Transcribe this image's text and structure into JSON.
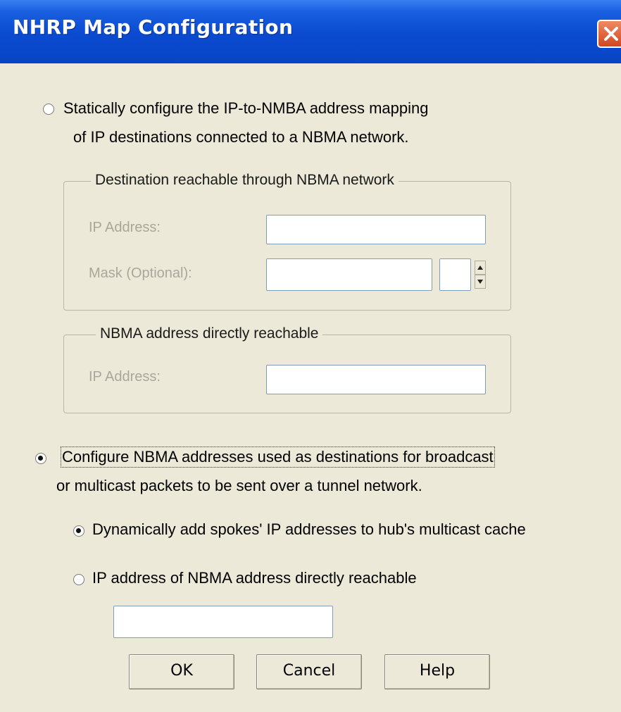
{
  "window": {
    "title": "NHRP Map Configuration"
  },
  "option_static": {
    "line1": "Statically configure the IP-to-NMBA address mapping",
    "line2": "of IP destinations connected to a NBMA network.",
    "selected": false
  },
  "group_destination": {
    "legend": "Destination reachable through NBMA network",
    "ip_label": "IP Address:",
    "ip_value": "",
    "mask_label": "Mask (Optional):",
    "mask_value": "",
    "prefix_value": ""
  },
  "group_nbma": {
    "legend": "NBMA address directly reachable",
    "ip_label": "IP Address:",
    "ip_value": ""
  },
  "option_multicast": {
    "line1": "Configure NBMA addresses used as destinations for broadcast",
    "line2": "or multicast packets to be sent over a tunnel network.",
    "selected": true
  },
  "sub_dynamic": {
    "label": "Dynamically add spokes' IP addresses to hub's multicast cache",
    "selected": true
  },
  "sub_static_ip": {
    "label": "IP address of NBMA address directly reachable",
    "selected": false,
    "value": ""
  },
  "buttons": {
    "ok": "OK",
    "cancel": "Cancel",
    "help": "Help"
  },
  "icons": {
    "close": "close-icon",
    "spin_up": "arrow-up-icon",
    "spin_down": "arrow-down-icon"
  }
}
